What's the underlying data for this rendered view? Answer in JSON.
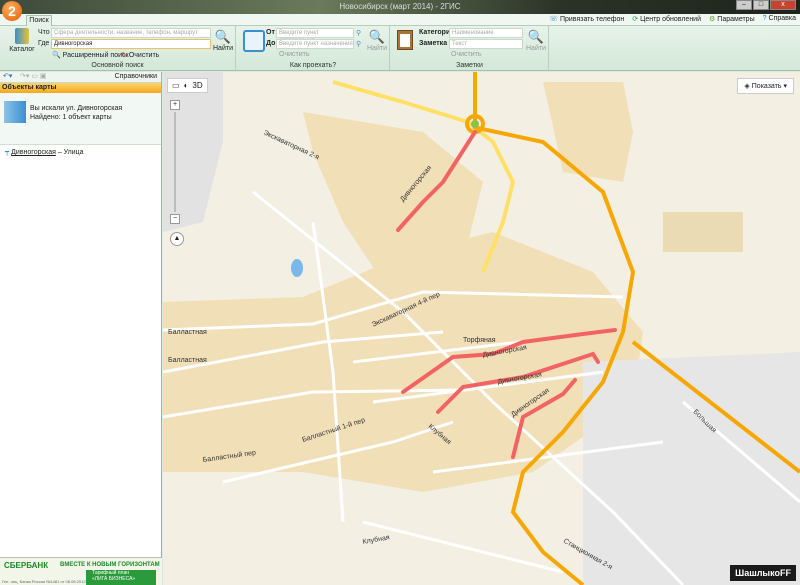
{
  "window": {
    "title": "Новосибирск (март 2014) - 2ГИС",
    "logo": "2",
    "minimize": "–",
    "maximize": "□",
    "close": "x"
  },
  "tabs": [
    {
      "label": "Поиск"
    }
  ],
  "top_links": [
    {
      "icon": "phone-icon",
      "label": "Привязать телефон"
    },
    {
      "icon": "refresh-icon",
      "label": "Центр обновлений"
    },
    {
      "icon": "gear-icon",
      "label": "Параметры"
    },
    {
      "icon": "help-icon",
      "label": "Справка"
    }
  ],
  "search": {
    "catalog": "Каталог",
    "what_label": "Что",
    "what_placeholder": "Сфера деятельности, название, телефон, маршрут",
    "where_label": "Где",
    "where_value": "Дивногорская",
    "find": "Найти",
    "advanced": "Расширенный поиск",
    "clear": "Очистить",
    "group": "Основной поиск"
  },
  "route": {
    "from_label": "От",
    "from_placeholder": "Введите пункт отправления",
    "to_label": "До",
    "to_placeholder": "Введите пункт назначения",
    "clear": "Очистить",
    "find": "Найти",
    "group": "Как проехать?"
  },
  "notes": {
    "category_label": "Категория",
    "category_placeholder": "Наименование",
    "note_label": "Заметка",
    "note_placeholder": "Текст",
    "clear": "Очистить",
    "find": "Найти",
    "group": "Заметки"
  },
  "left": {
    "directories": "Справочники",
    "panel_title": "Объекты карты",
    "searched": "Вы искали ул. Дивногорская",
    "found": "Найдено: 1 объект карты",
    "result_name": "Дивногорская",
    "result_type": "– Улица"
  },
  "banner": {
    "bank": "СБЕРБАНК",
    "slogan": "ВМЕСТЕ К НОВЫМ ГОРИЗОНТАМ",
    "plan1": "Тарифный план",
    "plan2": "«ЛИГА БИЗНЕСА»",
    "fine": "Ген. лиц. Банка России №1481 от 08.08.2012"
  },
  "map": {
    "mode3d": "3D",
    "show": "Показать",
    "corner_logo": "ШашлыкоFF",
    "labels": [
      "Экскаваторная 2-я",
      "Дивногорская",
      "Экскаваторная 4-й пер",
      "Балластная",
      "Балластная",
      "Торфяная",
      "Дивногорская",
      "Дивногорская",
      "Дивногорская",
      "Балластный 1-й пер",
      "Балластный пер",
      "Клубная",
      "Клубная",
      "Большая",
      "Станционная 2-я"
    ]
  }
}
